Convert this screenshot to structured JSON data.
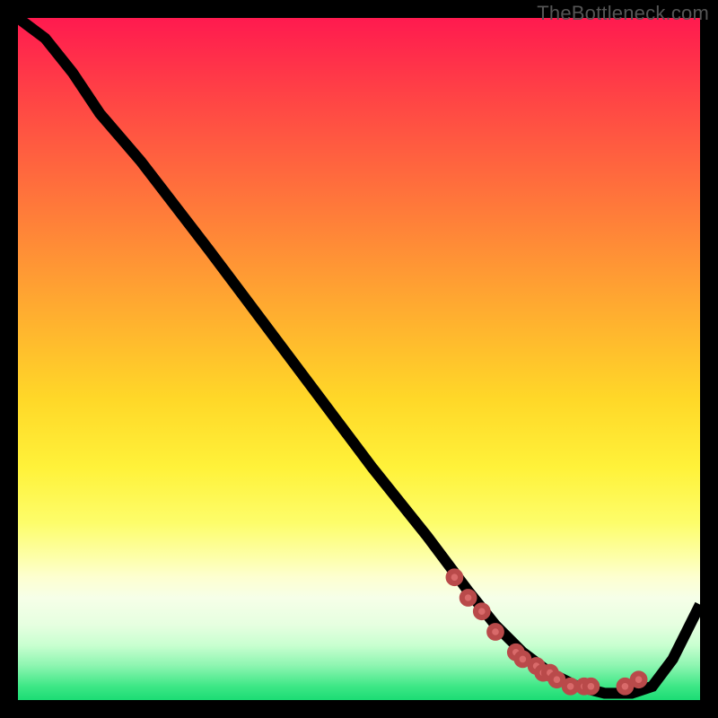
{
  "watermark": "TheBottleneck.com",
  "chart_data": {
    "type": "line",
    "title": "",
    "xlabel": "",
    "ylabel": "",
    "xlim": [
      0,
      100
    ],
    "ylim": [
      0,
      100
    ],
    "grid": false,
    "legend": false,
    "background": "gradient_red_to_green",
    "series": [
      {
        "name": "curve",
        "x": [
          0,
          4,
          8,
          12,
          18,
          28,
          40,
          52,
          60,
          66,
          70,
          74,
          78,
          82,
          86,
          90,
          93,
          96,
          100
        ],
        "y": [
          100,
          97,
          92,
          86,
          79,
          66,
          50,
          34,
          24,
          16,
          11,
          7,
          4,
          2,
          1,
          1,
          2,
          6,
          14
        ]
      }
    ],
    "markers": {
      "name": "highlighted-points",
      "color": "#d96a6a",
      "x": [
        64,
        66,
        68,
        70,
        73,
        74,
        76,
        77,
        78,
        79,
        81,
        83,
        84,
        89,
        91
      ],
      "y": [
        18,
        15,
        13,
        10,
        7,
        6,
        5,
        4,
        4,
        3,
        2,
        2,
        2,
        2,
        3
      ]
    }
  }
}
